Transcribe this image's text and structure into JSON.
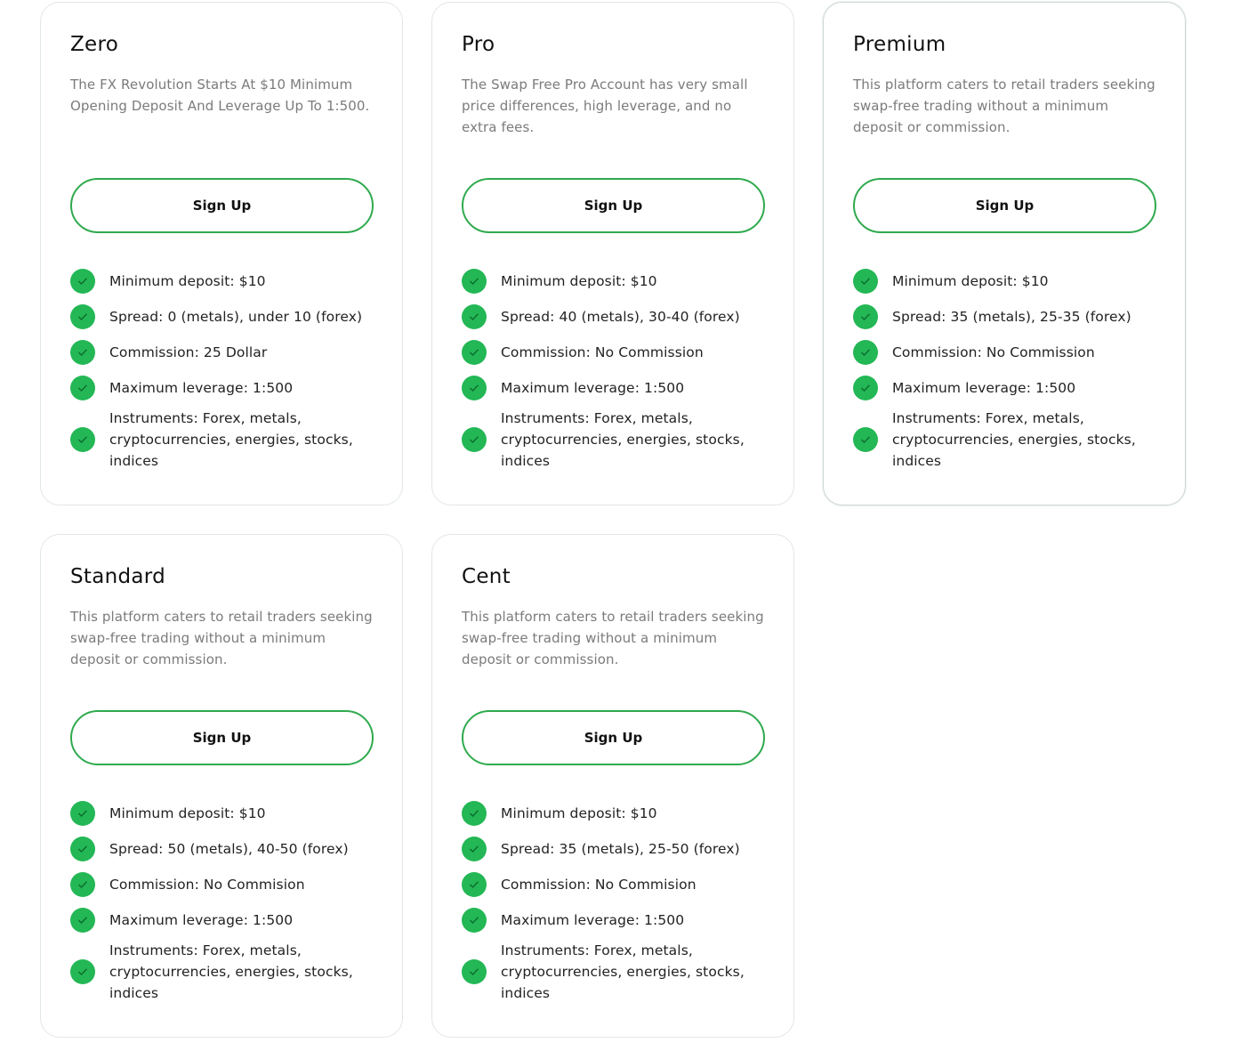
{
  "plans": [
    {
      "title": "Zero",
      "description": "The FX Revolution Starts At $10 Minimum Opening Deposit And Leverage Up To 1:500.",
      "button_label": "Sign Up",
      "features": [
        "Minimum deposit: $10",
        "Spread: 0 (metals), under 10 (forex)",
        "Commission: 25 Dollar",
        "Maximum leverage: 1:500",
        "Instruments: Forex, metals, cryptocurrencies, energies, stocks, indices"
      ]
    },
    {
      "title": "Pro",
      "description": "The Swap Free Pro Account has very small price differences, high leverage, and no extra fees.",
      "button_label": "Sign Up",
      "features": [
        "Minimum deposit: $10",
        "Spread: 40 (metals), 30-40 (forex)",
        "Commission: No Commission",
        "Maximum leverage: 1:500",
        "Instruments: Forex, metals, cryptocurrencies, energies, stocks, indices"
      ]
    },
    {
      "title": "Premium",
      "description": "This platform caters to retail traders seeking swap-free trading without a minimum deposit or commission.",
      "button_label": "Sign Up",
      "features": [
        "Minimum deposit: $10",
        "Spread: 35 (metals), 25-35 (forex)",
        "Commission: No Commission",
        "Maximum leverage: 1:500",
        "Instruments: Forex, metals, cryptocurrencies, energies, stocks, indices"
      ]
    },
    {
      "title": "Standard",
      "description": "This platform caters to retail traders seeking swap-free trading without a minimum deposit or commission.",
      "button_label": "Sign Up",
      "features": [
        "Minimum deposit: $10",
        "Spread: 50 (metals), 40-50 (forex)",
        "Commission: No Commision",
        "Maximum leverage: 1:500",
        "Instruments: Forex, metals, cryptocurrencies, energies, stocks, indices"
      ]
    },
    {
      "title": "Cent",
      "description": "This platform caters to retail traders seeking swap-free trading without a minimum deposit or commission.",
      "button_label": "Sign Up",
      "features": [
        "Minimum deposit: $10",
        "Spread: 35 (metals), 25-50 (forex)",
        "Commission: No Commision",
        "Maximum leverage: 1:500",
        "Instruments: Forex, metals, cryptocurrencies, energies, stocks, indices"
      ]
    }
  ],
  "colors": {
    "accent_green": "#23b755",
    "button_border": "#2faa4e",
    "card_border": "#e1e7e4",
    "description_text": "#7b7b7b",
    "title_text": "#111111"
  },
  "icons": {
    "feature_bullet": "check-circle-icon"
  }
}
